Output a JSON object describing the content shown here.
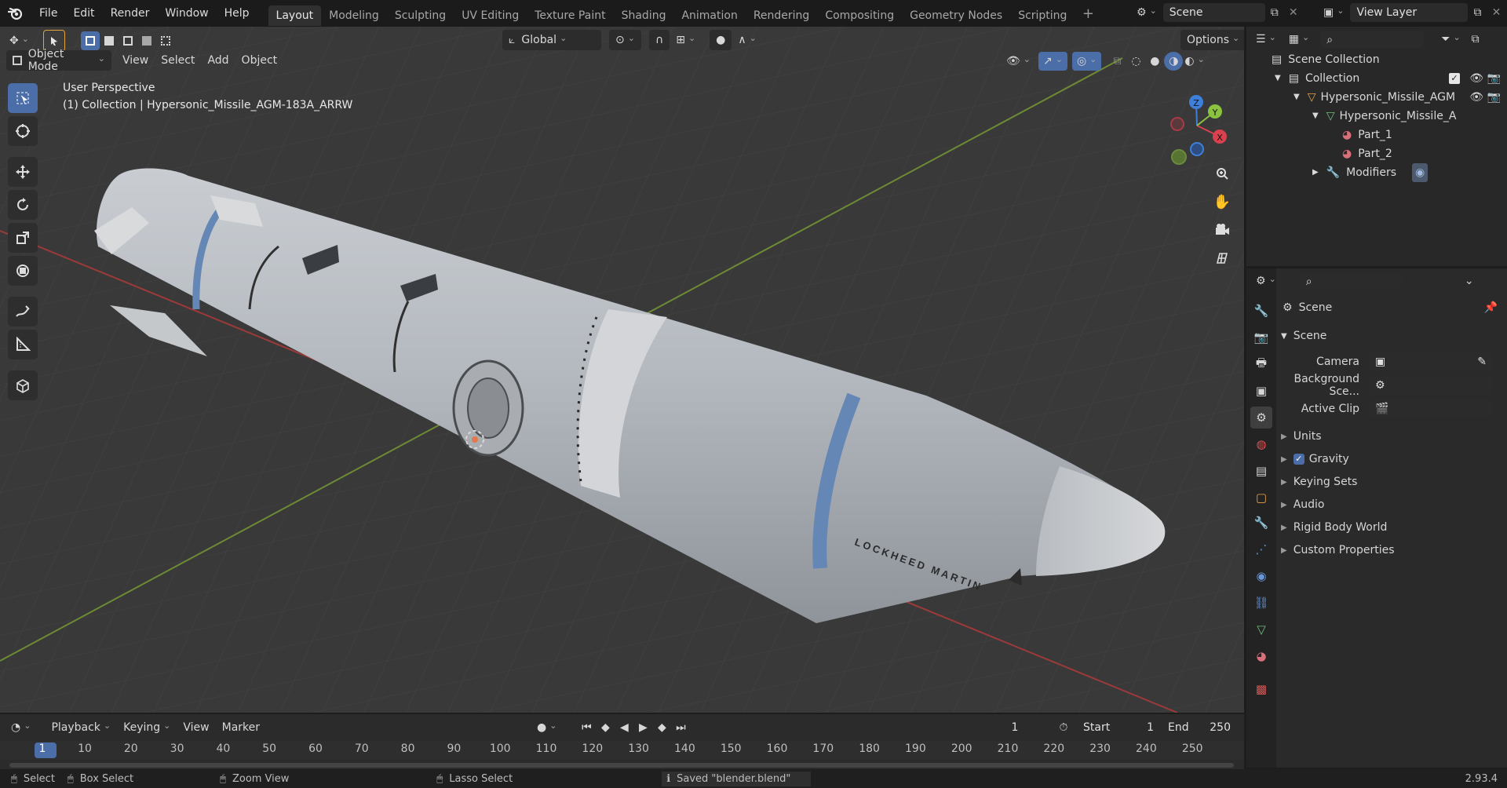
{
  "topbar": {
    "menus": [
      "File",
      "Edit",
      "Render",
      "Window",
      "Help"
    ],
    "workspaces": [
      "Layout",
      "Modeling",
      "Sculpting",
      "UV Editing",
      "Texture Paint",
      "Shading",
      "Animation",
      "Rendering",
      "Compositing",
      "Geometry Nodes",
      "Scripting"
    ],
    "active_workspace": "Layout",
    "scene_name": "Scene",
    "view_layer": "View Layer"
  },
  "viewport": {
    "mode": "Object Mode",
    "menus": [
      "View",
      "Select",
      "Add",
      "Object"
    ],
    "transform_orientation": "Global",
    "options_label": "Options",
    "overlay_title": "User Perspective",
    "overlay_subtitle": "(1) Collection | Hypersonic_Missile_AGM-183A_ARRW",
    "gizmo": {
      "x": "X",
      "y": "Y",
      "z": "Z"
    },
    "model_text": "LOCKHEED MARTIN"
  },
  "outliner": {
    "root": "Scene Collection",
    "collection": "Collection",
    "object": "Hypersonic_Missile_AGM",
    "mesh": "Hypersonic_Missile_A",
    "parts": [
      "Part_1",
      "Part_2"
    ],
    "modifiers": "Modifiers"
  },
  "properties": {
    "header": "Scene",
    "panel": "Scene",
    "fields": [
      {
        "label": "Camera",
        "value": ""
      },
      {
        "label": "Background Sce...",
        "value": ""
      },
      {
        "label": "Active Clip",
        "value": ""
      }
    ],
    "sections": [
      "Units",
      "Gravity",
      "Keying Sets",
      "Audio",
      "Rigid Body World",
      "Custom Properties"
    ],
    "gravity_checked": true
  },
  "timeline": {
    "menus": [
      "Playback",
      "Keying",
      "View",
      "Marker"
    ],
    "current_frame": "1",
    "start_label": "Start",
    "start": "1",
    "end_label": "End",
    "end": "250",
    "ticks": [
      "1",
      "10",
      "20",
      "30",
      "40",
      "50",
      "60",
      "70",
      "80",
      "90",
      "100",
      "110",
      "120",
      "130",
      "140",
      "150",
      "160",
      "170",
      "180",
      "190",
      "200",
      "210",
      "220",
      "230",
      "240",
      "250"
    ]
  },
  "statusbar": {
    "select": "Select",
    "box_select": "Box Select",
    "zoom_view": "Zoom View",
    "lasso_select": "Lasso Select",
    "message": "Saved \"blender.blend\"",
    "version": "2.93.4"
  },
  "colors": {
    "accent": "#4b6ea8",
    "x_axis": "#d9414f",
    "y_axis": "#8bc240",
    "z_axis": "#3f7fdc"
  }
}
